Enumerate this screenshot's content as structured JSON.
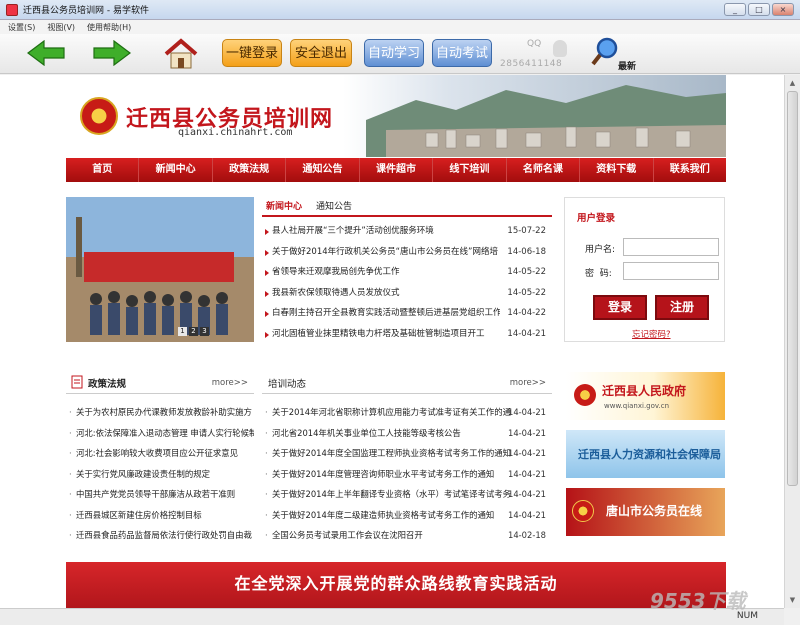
{
  "window": {
    "title": "迁西县公务员培训网 - 易学软件",
    "buttons": [
      "_",
      "□",
      "×"
    ]
  },
  "menu": [
    "设置(S)",
    "视图(V)",
    "使用帮助(H)"
  ],
  "toolbar": {
    "login": "一键登录",
    "logout": "安全退出",
    "auto_study": "自动学习",
    "auto_exam": "自动考试",
    "qq_label": "QQ",
    "qq_number": "2856411148",
    "newest": "最新"
  },
  "site": {
    "name": "迁西县公务员培训网",
    "url": "qianxi.chinahrt.com"
  },
  "nav": [
    "首页",
    "新闻中心",
    "政策法规",
    "通知公告",
    "课件超市",
    "线下培训",
    "名师名课",
    "资料下载",
    "联系我们"
  ],
  "slideshow": {
    "dots": [
      "1",
      "2",
      "3"
    ]
  },
  "news": {
    "tabs": [
      "新闻中心",
      "通知公告"
    ],
    "items": [
      {
        "title": "县人社局开展“三个提升”活动创优服务环境",
        "date": "15-07-22"
      },
      {
        "title": "关于做好2014年行政机关公务员“唐山市公务员在线”网络培",
        "date": "14-06-18"
      },
      {
        "title": "省领导来迁观摩我局创先争优工作",
        "date": "14-05-22"
      },
      {
        "title": "我县新农保领取待遇人员发放仪式",
        "date": "14-05-22"
      },
      {
        "title": "白春刚主持召开全县教育实践活动暨整顿后进基层党组织工作推",
        "date": "14-04-22"
      },
      {
        "title": "河北固植管业抹里精铁电力杆塔及基础桩管制造项目开工",
        "date": "14-04-21"
      }
    ]
  },
  "login": {
    "title": "用户登录",
    "user_label": "用户名:",
    "pass_label": "密  码:",
    "login_button": "登录",
    "register_button": "注册",
    "forgot": "忘记密码?"
  },
  "policy": {
    "title": "政策法规",
    "more": "more>>",
    "items": [
      "关于为农村原民办代课教师发放教龄补助实施方",
      "河北:依法保障准入退动态管理 申请人实行轮候制",
      "河北:社会影响较大收费项目应公开征求意见",
      "关于实行党风廉政建设责任制的规定",
      "中国共产党党员领导干部廉洁从政若干准则",
      "迁西县城区新建住房价格控制目标",
      "迁西县食品药品监督局依法行使行政处罚自由裁"
    ]
  },
  "training": {
    "title": "培训动态",
    "more": "more>>",
    "items": [
      {
        "title": "关于2014年河北省职称计算机应用能力考试准考证有关工作的通",
        "date": "14-04-21"
      },
      {
        "title": "河北省2014年机关事业单位工人技能等级考核公告",
        "date": "14-04-21"
      },
      {
        "title": "关于做好2014年度全国监理工程师执业资格考试考务工作的通知",
        "date": "14-04-21"
      },
      {
        "title": "关于做好2014年度管理咨询师职业水平考试考务工作的通知",
        "date": "14-04-21"
      },
      {
        "title": "关于做好2014年上半年翻译专业资格（水平）考试笔译考试考务",
        "date": "14-04-21"
      },
      {
        "title": "关于做好2014年度二级建造师执业资格考试考务工作的通知",
        "date": "14-04-21"
      },
      {
        "title": "全国公务员考试录用工作会议在沈阳召开",
        "date": "14-02-18"
      }
    ]
  },
  "ads": [
    {
      "title": "迁西县人民政府",
      "sub": "www.qianxi.gov.cn"
    },
    {
      "title": "迁西县人力资源和社会保障局"
    },
    {
      "title": "唐山市公务员在线"
    }
  ],
  "footer_banner": "在全党深入开展党的群众路线教育实践活动",
  "status": {
    "num": "NUM"
  },
  "watermark": "9553下载"
}
